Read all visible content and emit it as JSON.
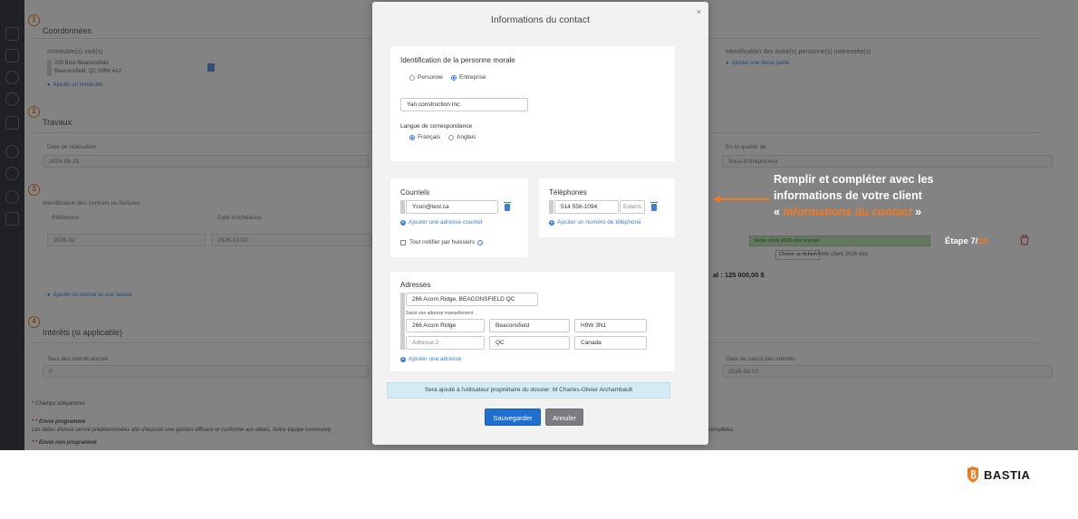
{
  "colors": {
    "accent": "#1f6fd1",
    "tutorial_orange": "#f07a21",
    "section_badge": "#d9822b",
    "link_blue": "#3b7ddd",
    "info_bar": "#d4ecf1",
    "upload_green": "#b8d9b4"
  },
  "background": {
    "sections": [
      {
        "number": "1",
        "title": "Coordonnées"
      },
      {
        "number": "2",
        "title": "Travaux"
      },
      {
        "number": "3",
        "title": ""
      },
      {
        "number": "4",
        "title": "Intérêts (si applicable)"
      }
    ],
    "coordonnees": {
      "immeuble_label": "Immeuble(s) visé(s)",
      "address_line1": "229 Boul Beaconsfield",
      "address_line2": "Beaconsfield, QC  H9W 4A2",
      "add_building": "Ajouter un immeuble",
      "others_label": "Identification des autre(s) personne(s) intéressée(s)",
      "add_third_party": "Ajouter une tierce partie"
    },
    "travaux": {
      "date_label": "Date de réalisation",
      "date_value": "2026-08-25",
      "quality_label": "En la qualité de",
      "quality_value": "Sous-Entrepreneur"
    },
    "contrats": {
      "id_label": "Identification des contrats ou factures",
      "ref_label": "Référence",
      "due_label": "Date d'échéance",
      "ref_value": "2026-02",
      "due_value": "2026-10-02",
      "upload_status": "Vente client 2026.xlsx envoyé",
      "file_button": "Choisir un fichier",
      "file_name": "Vente client 2026.xlsx",
      "total": "al : 125 000,00 $",
      "add_contract": "Ajouter un contrat ou une facture"
    },
    "interets": {
      "rate_label": "Taux des intérêt annuel",
      "rate_value": "0",
      "calc_date_label": "Date de calcul des intérêts",
      "calc_date_value": "2026-08-10"
    },
    "footer": {
      "required": "Champs obligatoires",
      "sched_title": "Envoi programmé",
      "sched_text": "Les dates d'envoi seront prédéterminées afin d'assurer une gestion efficace et conforme aux délais. Notre équipe communiq",
      "sched_tail": "complètes.",
      "unsched_title": "Envoi non programmé"
    }
  },
  "modal": {
    "title": "Informations du contact",
    "close": "×",
    "identification": {
      "heading": "Identification de la personne morale",
      "type_options": [
        {
          "label": "Personne",
          "selected": false
        },
        {
          "label": "Entreprise",
          "selected": true
        }
      ],
      "company_name": "Yan construction Inc.",
      "language_label": "Langue de correspondance",
      "language_options": [
        {
          "label": "Français",
          "selected": true
        },
        {
          "label": "Anglais",
          "selected": false
        }
      ]
    },
    "emails": {
      "heading": "Courriels",
      "email_value": "Ycon@test.ca",
      "add_email": "Ajouter une adresse courriel",
      "notify_label": "Tout notifier par huissiers"
    },
    "phones": {
      "heading": "Téléphones",
      "phone_value": "514 556-1094",
      "extension_placeholder": "Extens",
      "add_phone": "Ajouter un numéro de téléphone"
    },
    "addresses": {
      "heading": "Adresses",
      "search_value": "266 Acorn Ridge, BEACONSFIELD QC",
      "manual_label": "Saisir une adresse manuellement",
      "street": "266 Acorn Ridge",
      "city": "Beaconsfield",
      "postal": "H9W 3N1",
      "address2_placeholder": "Adresse 2",
      "province": "QC",
      "country": "Canada",
      "add_address": "Ajouter une adresse"
    },
    "info_text": "Sera ajouté à l'utilisateur propriétaire du dossier: M Charles-Olivier Archambault",
    "save_label": "Sauvegarder",
    "cancel_label": "Annuler"
  },
  "tutorial": {
    "line1": "Remplir et compléter avec les",
    "line2": "informations de votre client",
    "quote_open": "« ",
    "emphasis": "Informations du contact",
    "quote_close": " »",
    "step_prefix": "Étape 7/",
    "step_total": "18"
  },
  "logo": {
    "text": "BASTIA",
    "icon": "shield-b-icon"
  }
}
